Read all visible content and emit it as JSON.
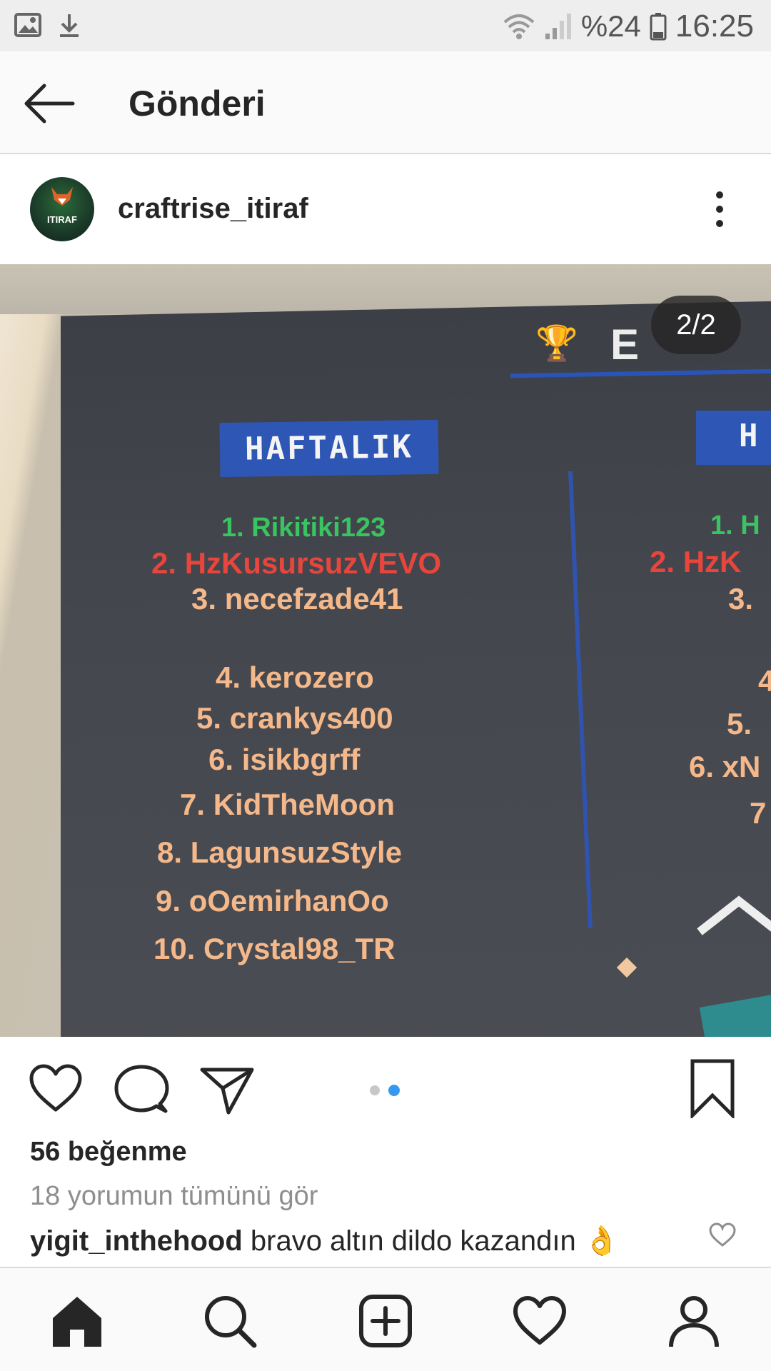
{
  "status_bar": {
    "battery_percent": "%24",
    "time": "16:25",
    "icons": [
      "image-icon",
      "download-icon",
      "wifi-icon",
      "signal-icon",
      "battery-icon"
    ]
  },
  "header": {
    "title": "Gönderi",
    "back_icon": "arrow-left-icon"
  },
  "post": {
    "username": "craftrise_itiraf",
    "avatar_text": "ITIRAF",
    "page_indicator": "2/2",
    "photo": {
      "tab_label": "HAFTALIK",
      "tab_right_label": "H",
      "title_partial": "E",
      "entries": [
        "1. Rikitiki123",
        "2. HzKusursuzVEVO",
        "3. necefzade41",
        "4. kerozero",
        "5. crankys400",
        "6. isikbgrff",
        "7. KidTheMoon",
        "8. LagunsuzStyle",
        "9. oOemirhanOo",
        "10. Crystal98_TR"
      ],
      "right_entries": [
        "1. H",
        "2. HzK",
        "3.",
        "4",
        "5.",
        "6. xN",
        "7"
      ]
    },
    "likes": "56 beğenme",
    "view_comments": "18 yorumun tümünü gör",
    "comment": {
      "user": "yigit_inthehood",
      "text": "bravo altın dildo kazandın 👌"
    },
    "carousel": {
      "count": 2,
      "active_index": 1
    }
  },
  "colors": {
    "accent_blue": "#3897f0",
    "text": "#262626",
    "muted": "#8e8e8e"
  },
  "bottom_nav": [
    "home-icon",
    "search-icon",
    "add-post-icon",
    "heart-icon",
    "profile-icon"
  ]
}
